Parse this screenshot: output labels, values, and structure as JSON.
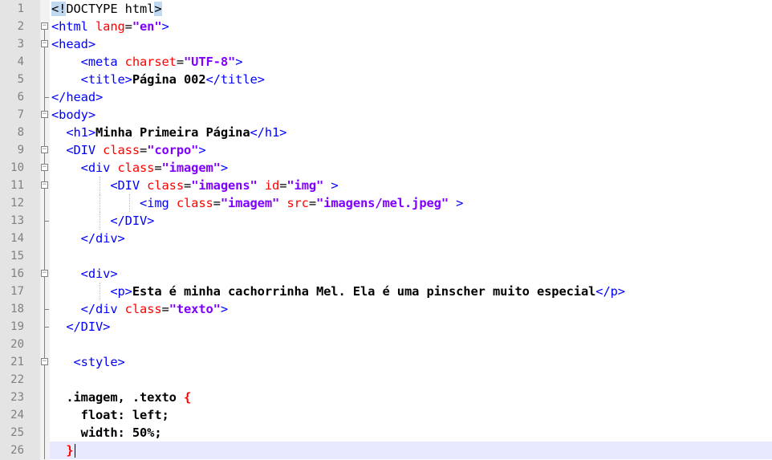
{
  "editor": {
    "current_line": 26,
    "colors": {
      "tag": "#0000ff",
      "attribute": "#ff0000",
      "value": "#8000ff",
      "text": "#000000",
      "gutter": "#e4e4e4",
      "current_line_bg": "#e8e8ff"
    },
    "lines": [
      {
        "n": "1",
        "fold": "none",
        "indent": 0,
        "tokens": [
          [
            "doc-hl",
            "<!"
          ],
          [
            "doc",
            "DOCTYPE html"
          ],
          [
            "doc-hl",
            ">"
          ]
        ]
      },
      {
        "n": "2",
        "fold": "open",
        "indent": 0,
        "tokens": [
          [
            "tag",
            "<html "
          ],
          [
            "attr",
            "lang"
          ],
          [
            "eq",
            "="
          ],
          [
            "val",
            "\"en\""
          ],
          [
            "tag",
            ">"
          ]
        ]
      },
      {
        "n": "3",
        "fold": "open",
        "indent": 0,
        "tokens": [
          [
            "tag",
            "<head>"
          ]
        ]
      },
      {
        "n": "4",
        "fold": "line",
        "indent": 0,
        "tokens": [
          [
            "tag",
            "    <meta "
          ],
          [
            "attr",
            "charset"
          ],
          [
            "eq",
            "="
          ],
          [
            "val",
            "\"UTF-8\""
          ],
          [
            "tag",
            ">"
          ]
        ]
      },
      {
        "n": "5",
        "fold": "line",
        "indent": 0,
        "tokens": [
          [
            "tag",
            "    <title>"
          ],
          [
            "txt",
            "Página 002"
          ],
          [
            "tag",
            "</title>"
          ]
        ]
      },
      {
        "n": "6",
        "fold": "end",
        "indent": 0,
        "tokens": [
          [
            "tag",
            "</head>"
          ]
        ]
      },
      {
        "n": "7",
        "fold": "open",
        "indent": 0,
        "tokens": [
          [
            "tag",
            "<body>"
          ]
        ]
      },
      {
        "n": "8",
        "fold": "line",
        "indent": 0,
        "tokens": [
          [
            "tag",
            "  <h1>"
          ],
          [
            "txt",
            "Minha Primeira Página"
          ],
          [
            "tag",
            "</h1>"
          ]
        ]
      },
      {
        "n": "9",
        "fold": "open",
        "indent": 0,
        "tokens": [
          [
            "tag",
            "  <DIV "
          ],
          [
            "attr",
            "class"
          ],
          [
            "eq",
            "="
          ],
          [
            "val",
            "\"corpo\""
          ],
          [
            "tag",
            ">"
          ]
        ]
      },
      {
        "n": "10",
        "fold": "open",
        "indent": 0,
        "tokens": [
          [
            "tag",
            "    <div "
          ],
          [
            "attr",
            "class"
          ],
          [
            "eq",
            "="
          ],
          [
            "val",
            "\"imagem\""
          ],
          [
            "tag",
            ">"
          ]
        ]
      },
      {
        "n": "11",
        "fold": "open",
        "indent": 0,
        "tokens": [
          [
            "tag",
            "        <DIV "
          ],
          [
            "attr",
            "class"
          ],
          [
            "eq",
            "="
          ],
          [
            "val",
            "\"imagens\""
          ],
          [
            "tag",
            " "
          ],
          [
            "attr",
            "id"
          ],
          [
            "eq",
            "="
          ],
          [
            "val",
            "\"img\""
          ],
          [
            "tag",
            " >"
          ]
        ]
      },
      {
        "n": "12",
        "fold": "line",
        "indent": 0,
        "tokens": [
          [
            "tag",
            "            <img "
          ],
          [
            "attr",
            "class"
          ],
          [
            "eq",
            "="
          ],
          [
            "val",
            "\"imagem\""
          ],
          [
            "tag",
            " "
          ],
          [
            "attr",
            "src"
          ],
          [
            "eq",
            "="
          ],
          [
            "val",
            "\"imagens/mel.jpeg\""
          ],
          [
            "tag",
            " >"
          ]
        ]
      },
      {
        "n": "13",
        "fold": "end",
        "indent": 0,
        "tokens": [
          [
            "tag",
            "        </DIV>"
          ]
        ]
      },
      {
        "n": "14",
        "fold": "line",
        "indent": 0,
        "tokens": [
          [
            "tag",
            "    </div>"
          ]
        ]
      },
      {
        "n": "15",
        "fold": "line",
        "indent": 0,
        "tokens": []
      },
      {
        "n": "16",
        "fold": "open",
        "indent": 0,
        "tokens": [
          [
            "tag",
            "    <div>"
          ]
        ]
      },
      {
        "n": "17",
        "fold": "line",
        "indent": 0,
        "tokens": [
          [
            "tag",
            "        <p>"
          ],
          [
            "txt",
            "Esta é minha cachorrinha Mel. Ela é uma pinscher muito especial"
          ],
          [
            "tag",
            "</p>"
          ]
        ]
      },
      {
        "n": "18",
        "fold": "end",
        "indent": 0,
        "tokens": [
          [
            "tag",
            "    </div "
          ],
          [
            "attr",
            "class"
          ],
          [
            "eq",
            "="
          ],
          [
            "val",
            "\"texto\""
          ],
          [
            "tag",
            ">"
          ]
        ]
      },
      {
        "n": "19",
        "fold": "end",
        "indent": 0,
        "tokens": [
          [
            "tag",
            "  </DIV>"
          ]
        ]
      },
      {
        "n": "20",
        "fold": "line",
        "indent": 0,
        "tokens": []
      },
      {
        "n": "21",
        "fold": "open",
        "indent": 0,
        "tokens": [
          [
            "tag",
            "   <style>"
          ]
        ]
      },
      {
        "n": "22",
        "fold": "line",
        "indent": 0,
        "tokens": []
      },
      {
        "n": "23",
        "fold": "line",
        "indent": 0,
        "tokens": [
          [
            "css",
            "  .imagem, .texto "
          ],
          [
            "brace",
            "{"
          ]
        ]
      },
      {
        "n": "24",
        "fold": "line",
        "indent": 0,
        "tokens": [
          [
            "css",
            "    float: left;"
          ]
        ]
      },
      {
        "n": "25",
        "fold": "line",
        "indent": 0,
        "tokens": [
          [
            "css",
            "    width: 50%;"
          ]
        ]
      },
      {
        "n": "26",
        "fold": "line",
        "indent": 0,
        "tokens": [
          [
            "brace-hl",
            "  }"
          ],
          [
            "caret",
            ""
          ]
        ]
      }
    ]
  }
}
